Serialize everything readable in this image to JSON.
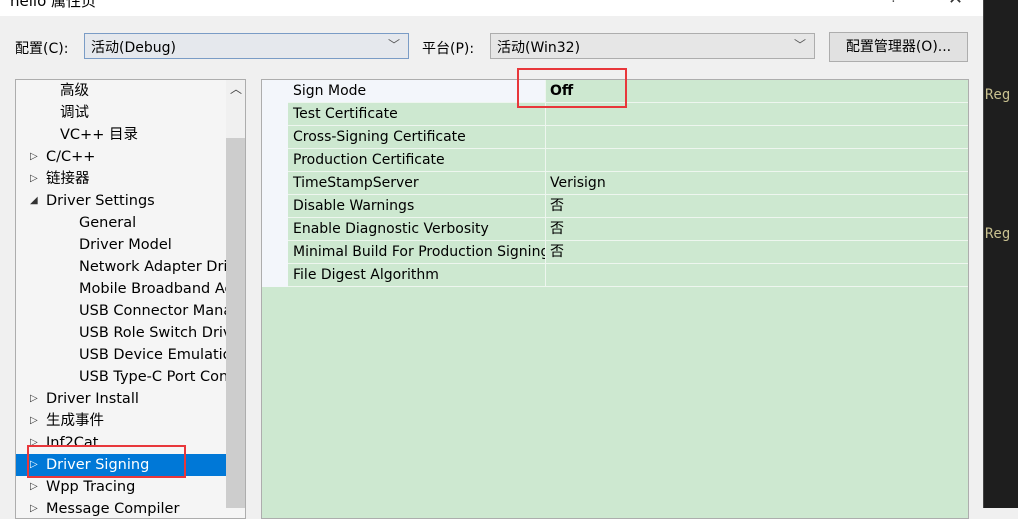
{
  "window": {
    "title": "hello 属性页",
    "help": "?",
    "close": "✕"
  },
  "editor": {
    "lines": [
      "Reg",
      "Reg"
    ]
  },
  "config": {
    "label": "配置(C):",
    "value": "活动(Debug)"
  },
  "platform": {
    "label": "平台(P):",
    "value": "活动(Win32)"
  },
  "config_manager_label": "配置管理器(O)...",
  "tree": {
    "items": [
      {
        "label": "高级",
        "indent": 2,
        "arrow": ""
      },
      {
        "label": "调试",
        "indent": 2,
        "arrow": ""
      },
      {
        "label": "VC++ 目录",
        "indent": 2,
        "arrow": ""
      },
      {
        "label": "C/C++",
        "indent": 1,
        "arrow": "▷"
      },
      {
        "label": "链接器",
        "indent": 1,
        "arrow": "▷"
      },
      {
        "label": "Driver Settings",
        "indent": 1,
        "arrow": "◢"
      },
      {
        "label": "General",
        "indent": 3,
        "arrow": ""
      },
      {
        "label": "Driver Model",
        "indent": 3,
        "arrow": ""
      },
      {
        "label": "Network Adapter Driver",
        "indent": 3,
        "arrow": ""
      },
      {
        "label": "Mobile Broadband Adapter",
        "indent": 3,
        "arrow": ""
      },
      {
        "label": "USB Connector Manager",
        "indent": 3,
        "arrow": ""
      },
      {
        "label": "USB Role Switch Driver",
        "indent": 3,
        "arrow": ""
      },
      {
        "label": "USB Device Emulation",
        "indent": 3,
        "arrow": ""
      },
      {
        "label": "USB Type-C Port Controller",
        "indent": 3,
        "arrow": ""
      },
      {
        "label": "Driver Install",
        "indent": 1,
        "arrow": "▷"
      },
      {
        "label": "生成事件",
        "indent": 1,
        "arrow": "▷"
      },
      {
        "label": "Inf2Cat",
        "indent": 1,
        "arrow": "▷"
      },
      {
        "label": "Driver Signing",
        "indent": 1,
        "arrow": "▷",
        "selected": true
      },
      {
        "label": "Wpp Tracing",
        "indent": 1,
        "arrow": "▷"
      },
      {
        "label": "Message Compiler",
        "indent": 1,
        "arrow": "▷"
      }
    ]
  },
  "properties": [
    {
      "name": "Sign Mode",
      "value": "Off"
    },
    {
      "name": "Test Certificate",
      "value": ""
    },
    {
      "name": "Cross-Signing Certificate",
      "value": ""
    },
    {
      "name": "Production Certificate",
      "value": ""
    },
    {
      "name": "TimeStampServer",
      "value": "Verisign"
    },
    {
      "name": "Disable Warnings",
      "value": "否"
    },
    {
      "name": "Enable Diagnostic Verbosity",
      "value": "否"
    },
    {
      "name": "Minimal Build For Production Signing",
      "value": "否"
    },
    {
      "name": "File Digest Algorithm",
      "value": ""
    }
  ],
  "colors": {
    "grid_bg": "#cde8d0",
    "selection": "#0078d7",
    "highlight_box": "#e8373b"
  }
}
